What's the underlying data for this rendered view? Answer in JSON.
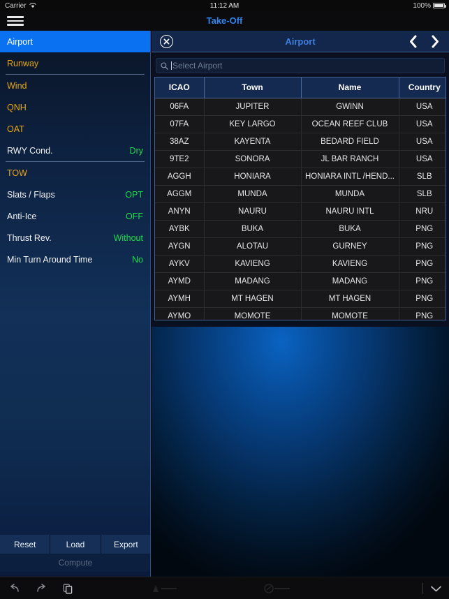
{
  "status_bar": {
    "carrier": "Carrier",
    "wifi_icon": "wifi-icon",
    "time": "11:12 AM",
    "battery_percent": "100%",
    "battery_icon": "battery-icon"
  },
  "nav": {
    "menu_icon": "hamburger-menu-icon",
    "title": "Take-Off"
  },
  "sidebar": {
    "items": [
      {
        "label": "Airport",
        "value": "",
        "selected": true,
        "type": "param"
      },
      {
        "label": "Runway",
        "value": "",
        "selected": false,
        "type": "param"
      },
      {
        "label": "Wind",
        "value": "",
        "selected": false,
        "type": "param"
      },
      {
        "label": "QNH",
        "value": "",
        "selected": false,
        "type": "param"
      },
      {
        "label": "OAT",
        "value": "",
        "selected": false,
        "type": "param"
      },
      {
        "label": "RWY Cond.",
        "value": "Dry",
        "selected": false,
        "type": "setting"
      },
      {
        "label": "TOW",
        "value": "",
        "selected": false,
        "type": "param"
      },
      {
        "label": "Slats / Flaps",
        "value": "OPT",
        "selected": false,
        "type": "setting"
      },
      {
        "label": "Anti-Ice",
        "value": "OFF",
        "selected": false,
        "type": "setting"
      },
      {
        "label": "Thrust Rev.",
        "value": "Without",
        "selected": false,
        "type": "setting"
      },
      {
        "label": "Min Turn Around Time",
        "value": "No",
        "selected": false,
        "type": "setting"
      }
    ],
    "actions": {
      "reset": "Reset",
      "load": "Load",
      "export": "Export",
      "compute": "Compute"
    }
  },
  "panel": {
    "close_icon": "close-circle-icon",
    "title": "Airport",
    "prev_icon": "chevron-left-icon",
    "next_icon": "chevron-right-icon",
    "search": {
      "icon": "search-icon",
      "placeholder": "Select Airport",
      "value": ""
    },
    "table": {
      "columns": [
        "ICAO",
        "Town",
        "Name",
        "Country"
      ],
      "rows": [
        [
          "06FA",
          "JUPITER",
          "GWINN",
          "USA"
        ],
        [
          "07FA",
          "KEY LARGO",
          "OCEAN REEF CLUB",
          "USA"
        ],
        [
          "38AZ",
          "KAYENTA",
          "BEDARD FIELD",
          "USA"
        ],
        [
          "9TE2",
          "SONORA",
          "JL BAR RANCH",
          "USA"
        ],
        [
          "AGGH",
          "HONIARA",
          "HONIARA INTL /HEND...",
          "SLB"
        ],
        [
          "AGGM",
          "MUNDA",
          "MUNDA",
          "SLB"
        ],
        [
          "ANYN",
          "NAURU",
          "NAURU INTL",
          "NRU"
        ],
        [
          "AYBK",
          "BUKA",
          "BUKA",
          "PNG"
        ],
        [
          "AYGN",
          "ALOTAU",
          "GURNEY",
          "PNG"
        ],
        [
          "AYKV",
          "KAVIENG",
          "KAVIENG",
          "PNG"
        ],
        [
          "AYMD",
          "MADANG",
          "MADANG",
          "PNG"
        ],
        [
          "AYMH",
          "MT HAGEN",
          "MT HAGEN",
          "PNG"
        ],
        [
          "AYMO",
          "MOMOTE",
          "MOMOTE",
          "PNG"
        ]
      ]
    }
  },
  "keyboard_bar": {
    "undo_icon": "undo-icon",
    "redo_icon": "redo-icon",
    "paste_icon": "paste-icon",
    "dismiss_icon": "chevron-down-icon"
  },
  "colors": {
    "accent_blue": "#0a72f0",
    "title_blue": "#2f86f0",
    "param_gold": "#e8a617",
    "value_green": "#19dd4a",
    "panel_header": "#13264b",
    "table_header": "#152a50",
    "table_row": "#18181a"
  }
}
